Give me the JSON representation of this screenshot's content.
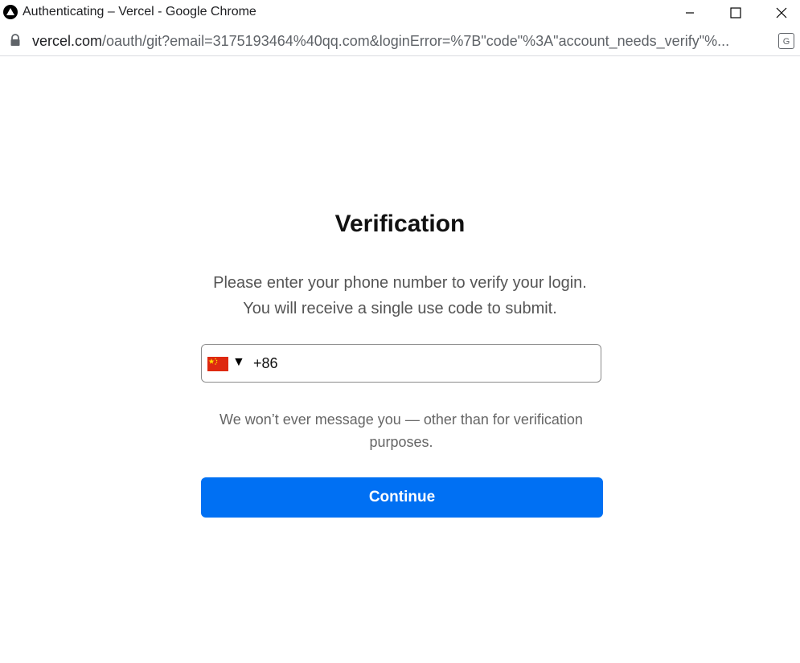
{
  "window": {
    "title": "Authenticating – Vercel - Google Chrome"
  },
  "address_bar": {
    "host": "vercel.com",
    "path": "/oauth/git?email=3175193464%40qq.com&loginError=%7B\"code\"%3A\"account_needs_verify\"%..."
  },
  "page": {
    "heading": "Verification",
    "desc_line1": "Please enter your phone number to verify your login.",
    "desc_line2": "You will receive a single use code to submit.",
    "phone": {
      "country_caret": "▼",
      "value": "+86"
    },
    "note": "We won’t ever message you — other than for verification purposes.",
    "continue_label": "Continue"
  },
  "icons": {
    "app": "vercel-logo-icon",
    "lock": "lock-icon",
    "translate": "translate-icon",
    "flag": "china-flag-icon"
  },
  "colors": {
    "accent": "#0070f3",
    "flag_red": "#de2910",
    "flag_yellow": "#ffde00"
  }
}
